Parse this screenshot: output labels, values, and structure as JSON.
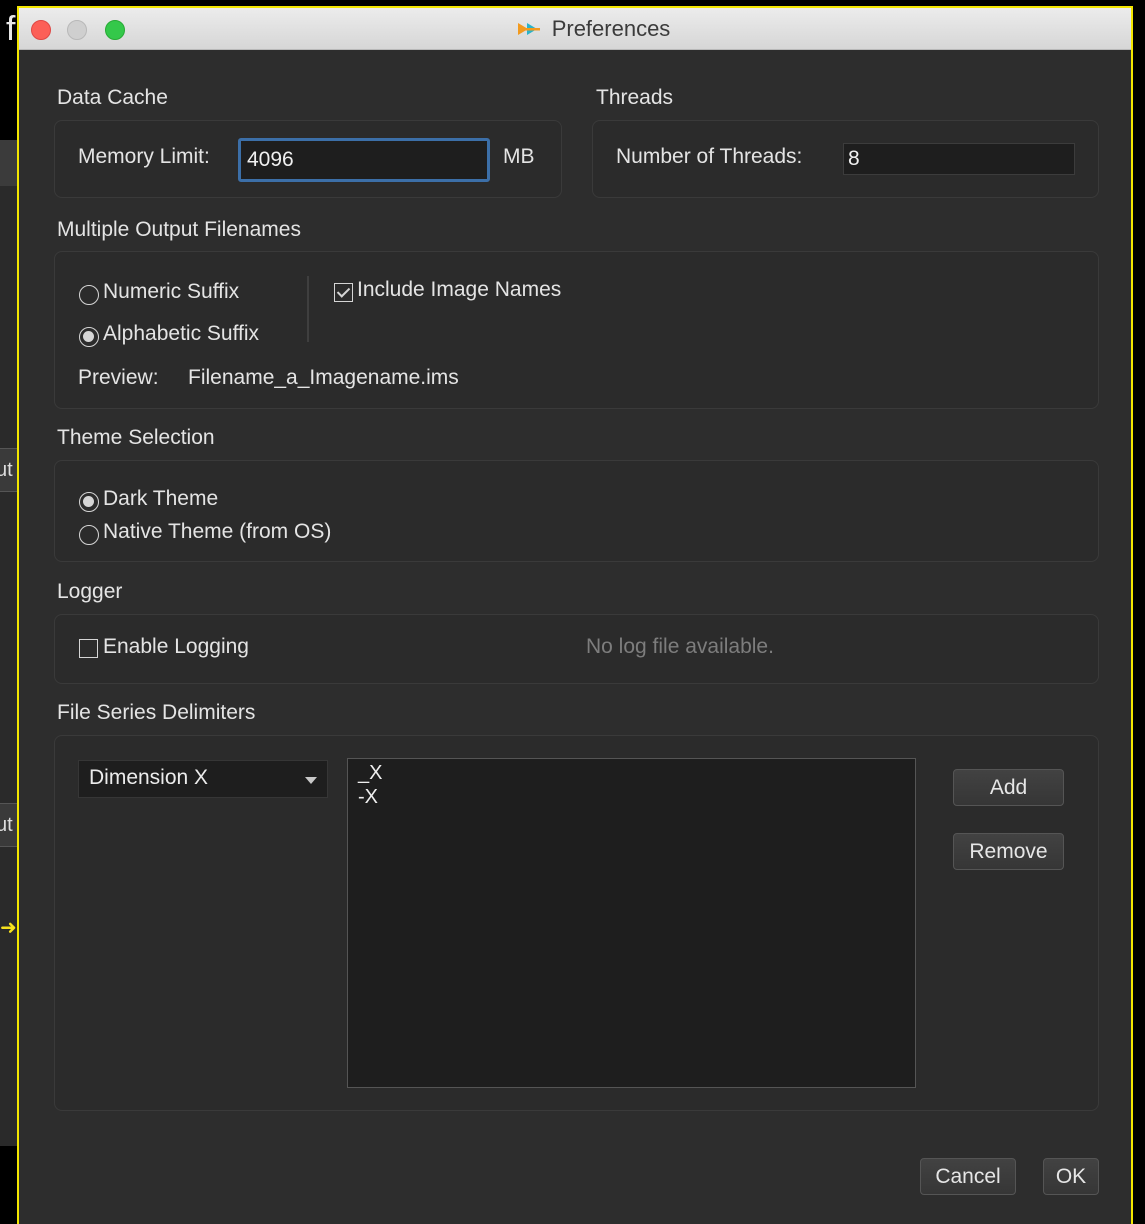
{
  "background": {
    "letter": "f",
    "btn1": "ut",
    "btn2": "ut"
  },
  "window": {
    "title": "Preferences"
  },
  "data_cache": {
    "label": "Data Cache",
    "memory_label": "Memory Limit:",
    "memory_value": "4096",
    "unit": "MB"
  },
  "threads": {
    "label": "Threads",
    "threads_label": "Number of Threads:",
    "threads_value": "8"
  },
  "output_filenames": {
    "label": "Multiple Output Filenames",
    "numeric": "Numeric Suffix",
    "alphabetic": "Alphabetic Suffix",
    "selected": "Alphabetic Suffix",
    "include_names": "Include Image Names",
    "include_names_checked": true,
    "preview_label": "Preview:",
    "preview_value": "Filename_a_Imagename.ims"
  },
  "theme": {
    "label": "Theme Selection",
    "dark": "Dark Theme",
    "native": "Native Theme (from OS)",
    "selected": "Dark Theme"
  },
  "logger": {
    "label": "Logger",
    "enable": "Enable Logging",
    "enabled": false,
    "status": "No log file available."
  },
  "delimiters": {
    "label": "File Series Delimiters",
    "dimension": "Dimension X",
    "items": [
      "_X",
      "-X"
    ],
    "add": "Add",
    "remove": "Remove"
  },
  "footer": {
    "cancel": "Cancel",
    "ok": "OK"
  },
  "colors": {
    "accent_focus": "#3c6fa8",
    "window_border": "#f3e600",
    "background": "#2d2d2d"
  }
}
